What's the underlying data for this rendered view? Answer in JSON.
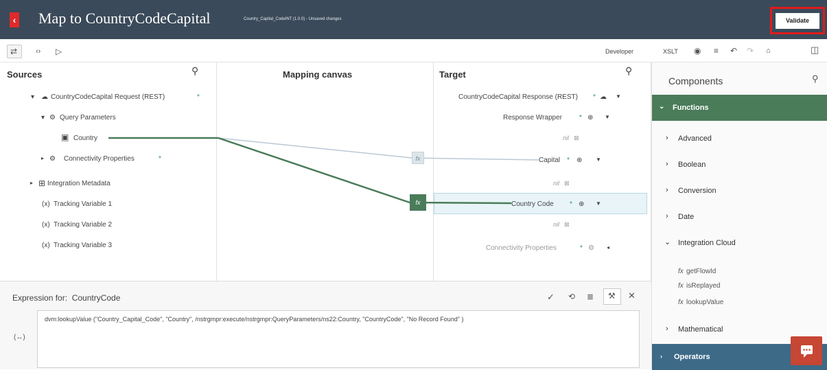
{
  "header": {
    "back_icon": "chevron-left-icon",
    "title": "Map to CountryCodeCapital",
    "subtitle": "Country_Capital_CodeINT (1.0.0) - Unsaved changes",
    "validate_label": "Validate"
  },
  "toolbar": {
    "developer_label": "Developer",
    "xslt_label": "XSLT",
    "icons": [
      "swap-icon",
      "code-icon",
      "play-icon",
      "eye-icon",
      "filter-icon",
      "undo-icon",
      "redo-icon",
      "pin-icon",
      "panel-icon"
    ]
  },
  "sources": {
    "heading": "Sources",
    "root": "CountryCodeCapital Request (REST)",
    "root_marker": "*",
    "query_parameters": "Query Parameters",
    "country": "Country",
    "connectivity": "Connectivity Properties",
    "connectivity_marker": "*",
    "integration_metadata": "Integration Metadata",
    "tracking": [
      "Tracking Variable 1",
      "Tracking Variable 2",
      "Tracking Variable 3"
    ],
    "tracking_prefix": "(x)"
  },
  "canvas": {
    "heading": "Mapping canvas",
    "fx_label": "fx"
  },
  "target": {
    "heading": "Target",
    "root": "CountryCodeCapital Response (REST)",
    "wrapper": "Response Wrapper",
    "capital": "Capital",
    "country_code": "Country Code",
    "connectivity": "Connectivity Properties",
    "marker": "*",
    "nil_label": "nil"
  },
  "components": {
    "heading": "Components",
    "functions_label": "Functions",
    "categories": [
      "Advanced",
      "Boolean",
      "Conversion",
      "Date",
      "Integration Cloud"
    ],
    "integration_cloud_functions": [
      "getFlowId",
      "isReplayed",
      "lookupValue"
    ],
    "fn_prefix": "fx",
    "mathematical_label": "Mathematical",
    "operators_label": "Operators",
    "colors": {
      "functions_band": "#4a7c59",
      "operators_band": "#3d6a87"
    }
  },
  "expression": {
    "label": "Expression for:  CountryCode",
    "text": "dvm:lookupValue (\"Country_Capital_Code\", \"Country\", /nstrgmpr:execute/nstrgmpr:QueryParameters/ns22:Country, \"CountryCode\", \"No Record Found\" )",
    "variable_icon_label": "(↔)"
  },
  "colors": {
    "header_bg": "#3b4a5a",
    "highlight": "#e01b1b",
    "line_primary": "#4a7c59",
    "line_secondary": "#b9c9d6"
  }
}
